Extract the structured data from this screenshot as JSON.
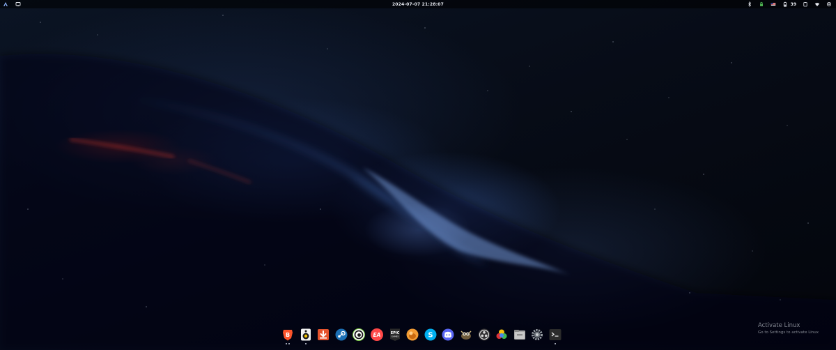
{
  "topbar": {
    "clock": "2024-07-07  21:28:07",
    "battery_percent": "39",
    "left_icons": [
      "app-launcher-icon",
      "workspace-icon"
    ],
    "right_icons": [
      "bluetooth-icon",
      "vpn-icon",
      "keyboard-flag-icon",
      "battery-icon",
      "clipboard-icon",
      "wifi-icon",
      "power-icon"
    ]
  },
  "dock": {
    "apps": [
      {
        "name": "brave",
        "icon": "brave-icon",
        "running": true,
        "windows": 2
      },
      {
        "name": "rhythmbox",
        "icon": "rhythmbox-icon",
        "running": true,
        "windows": 1
      },
      {
        "name": "downloader",
        "icon": "download-icon",
        "running": false,
        "windows": 0
      },
      {
        "name": "steam",
        "icon": "steam-icon",
        "running": false,
        "windows": 0
      },
      {
        "name": "ubisoft-connect",
        "icon": "ubisoft-icon",
        "running": false,
        "windows": 0
      },
      {
        "name": "ea-app",
        "icon": "ea-icon",
        "running": false,
        "windows": 0
      },
      {
        "name": "epic-games",
        "icon": "epic-games-icon",
        "running": false,
        "windows": 0
      },
      {
        "name": "gimp-like-app",
        "icon": "orange-app-icon",
        "running": false,
        "windows": 0
      },
      {
        "name": "skype",
        "icon": "skype-icon",
        "running": false,
        "windows": 0
      },
      {
        "name": "discord",
        "icon": "discord-icon",
        "running": false,
        "windows": 0
      },
      {
        "name": "gimp",
        "icon": "gimp-icon",
        "running": false,
        "windows": 0
      },
      {
        "name": "obs-studio",
        "icon": "obs-icon",
        "running": false,
        "windows": 0
      },
      {
        "name": "color-picker",
        "icon": "color-picker-icon",
        "running": false,
        "windows": 0
      },
      {
        "name": "files",
        "icon": "files-icon",
        "running": false,
        "windows": 0
      },
      {
        "name": "settings",
        "icon": "settings-icon",
        "running": false,
        "windows": 0
      },
      {
        "name": "terminal",
        "icon": "terminal-icon",
        "running": true,
        "windows": 1
      }
    ]
  },
  "watermark": {
    "title": "Activate Linux",
    "subtitle": "Go to Settings to activate Linux"
  },
  "labels": {
    "brave": "B",
    "ea": "EA",
    "epic_1": "EPIC",
    "epic_2": "GAMES",
    "skype": "S",
    "discord": "D"
  },
  "colors": {
    "brave": "#fb542b",
    "steam": "#1b6fb5",
    "ea": "#ff4747",
    "skype": "#00aff0",
    "discord": "#5865f2"
  }
}
